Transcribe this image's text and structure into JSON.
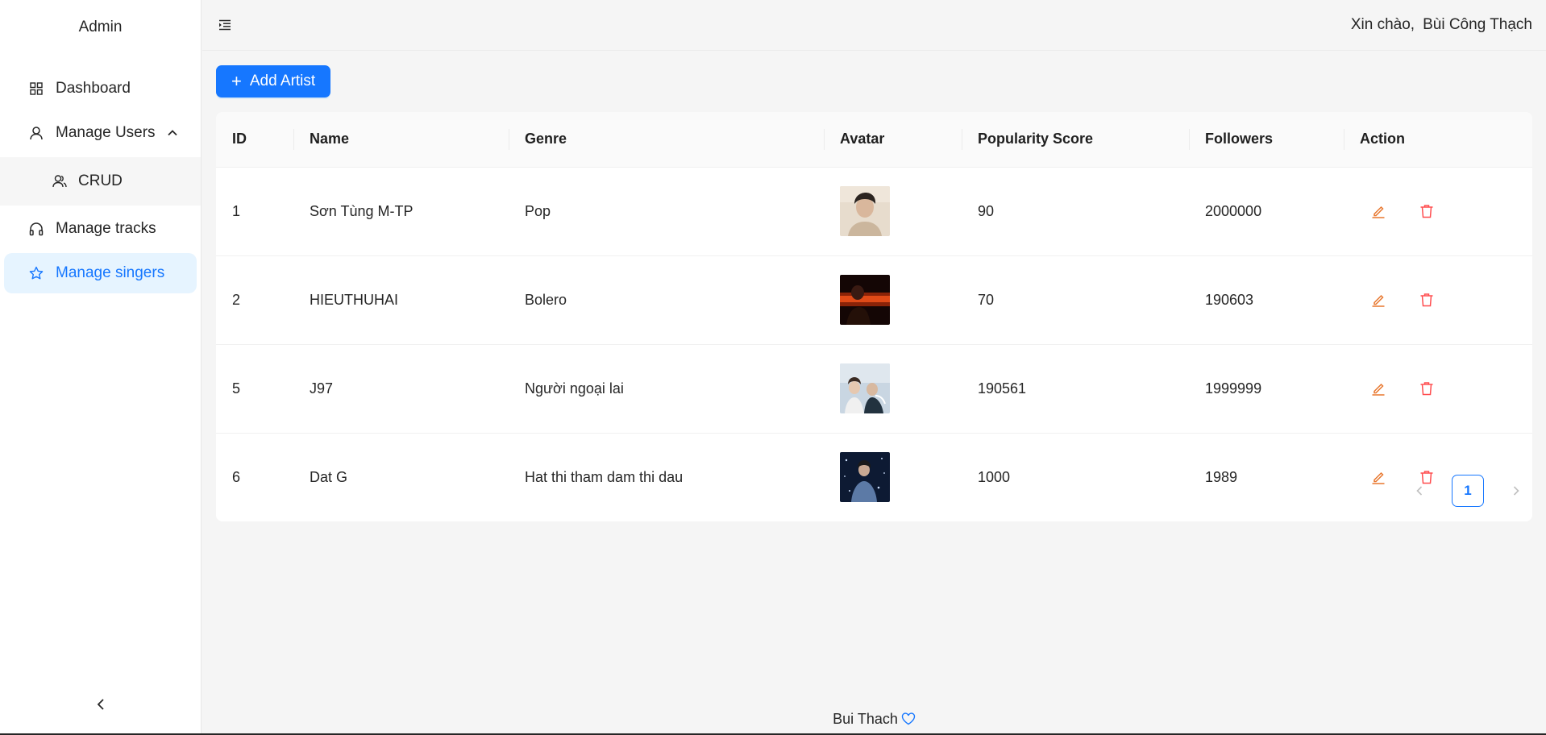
{
  "sidebar": {
    "brand": "Admin",
    "items": [
      {
        "label": "Dashboard",
        "icon": "dashboard-icon"
      },
      {
        "label": "Manage Users",
        "icon": "user-icon"
      },
      {
        "label": "CRUD",
        "icon": "team-icon"
      },
      {
        "label": "Manage tracks",
        "icon": "headphones-icon"
      },
      {
        "label": "Manage singers",
        "icon": "star-icon"
      }
    ],
    "collapse_icon": "chevron-left-icon"
  },
  "header": {
    "greeting": "Xin chào,",
    "user_name": "Bùi Công Thạch",
    "fold_icon": "menu-fold-icon"
  },
  "toolbar": {
    "add_label": "Add Artist"
  },
  "table": {
    "columns": [
      "ID",
      "Name",
      "Genre",
      "Avatar",
      "Popularity Score",
      "Followers",
      "Action"
    ],
    "rows": [
      {
        "id": "1",
        "name": "Sơn Tùng M-TP",
        "genre": "Pop",
        "popularity": "90",
        "followers": "2000000"
      },
      {
        "id": "2",
        "name": "HIEUTHUHAI",
        "genre": "Bolero",
        "popularity": "70",
        "followers": "190603"
      },
      {
        "id": "5",
        "name": "J97",
        "genre": "Người ngoại lai",
        "popularity": "190561",
        "followers": "1999999"
      },
      {
        "id": "6",
        "name": "Dat G",
        "genre": "Hat thi tham dam thi dau",
        "popularity": "1000",
        "followers": "1989"
      }
    ]
  },
  "pagination": {
    "current_page": "1"
  },
  "footer": {
    "text": "Bui Thach"
  },
  "colors": {
    "primary": "#1677ff",
    "edit": "#e8772e",
    "delete": "#ff4d4f",
    "active_bg": "#e6f4ff"
  }
}
